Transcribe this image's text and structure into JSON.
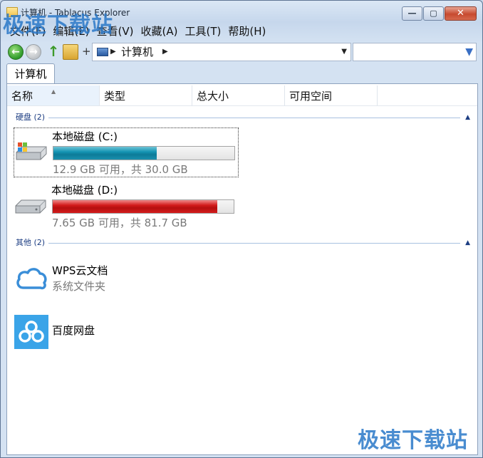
{
  "window": {
    "title": "计算机 - Tablacus Explorer"
  },
  "watermark": {
    "text": "极速下载站"
  },
  "menu": [
    "文件(F)",
    "编辑(E)",
    "查看(V)",
    "收藏(A)",
    "工具(T)",
    "帮助(H)"
  ],
  "nav": {
    "plus": "+",
    "address": "计算机",
    "search_placeholder": ""
  },
  "tab": {
    "label": "计算机"
  },
  "columns": [
    "名称",
    "类型",
    "总大小",
    "可用空间"
  ],
  "groups": {
    "drives": {
      "label": "硬盘 (2)"
    },
    "other": {
      "label": "其他 (2)"
    }
  },
  "drives": [
    {
      "name": "本地磁盘 (C:)",
      "usage": "12.9 GB 可用，共 30.0 GB",
      "used_fraction": 0.57,
      "bar_color": "teal"
    },
    {
      "name": "本地磁盘 (D:)",
      "usage": "7.65 GB 可用，共 81.7 GB",
      "used_fraction": 0.91,
      "bar_color": "red"
    }
  ],
  "others": [
    {
      "name": "WPS云文档",
      "sub": "系统文件夹"
    },
    {
      "name": "百度网盘",
      "sub": ""
    }
  ]
}
